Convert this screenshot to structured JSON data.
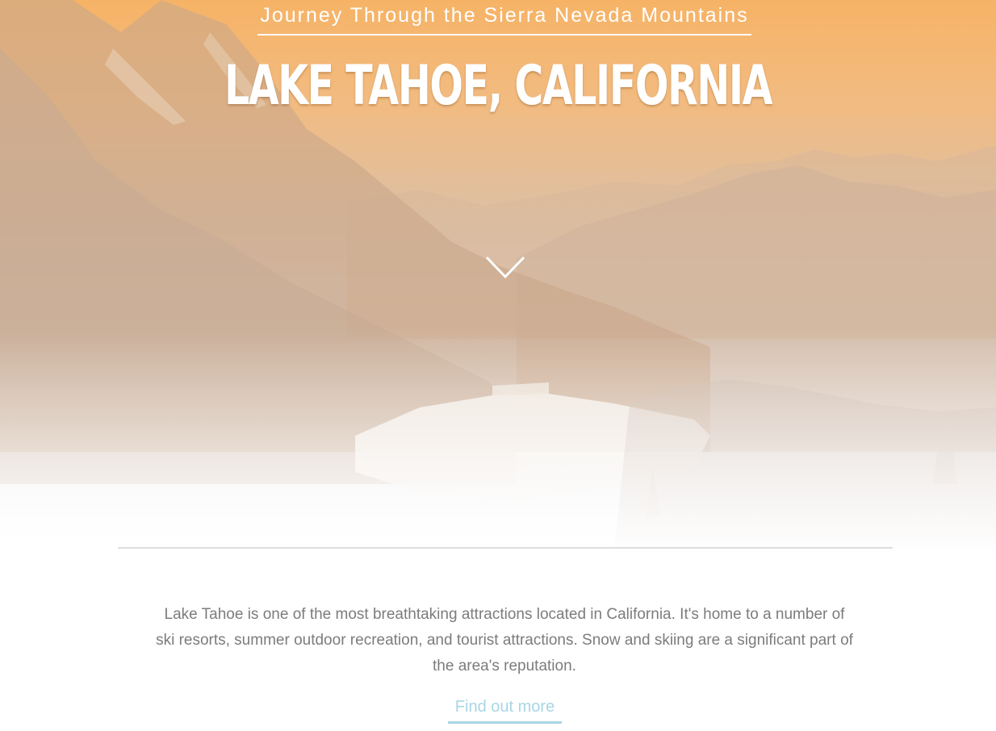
{
  "hero": {
    "tagline": "Journey Through the Sierra Nevada Mountains",
    "title": "LAKE TAHOE, CALIFORNIA",
    "scroll_icon": "chevron-down-icon",
    "background": "mountain-lake-landscape"
  },
  "intro": {
    "description": "Lake Tahoe is one of the most breathtaking attractions located in California. It's home to a number of ski resorts, summer outdoor recreation, and tourist attractions. Snow and skiing are a significant part of the area's reputation.",
    "cta_label": "Find out more"
  },
  "colors": {
    "hero_orange": "#f6b366",
    "text_gray": "#7c7c7c",
    "link_blue": "#a9d6e4",
    "divider": "#dddde0"
  }
}
